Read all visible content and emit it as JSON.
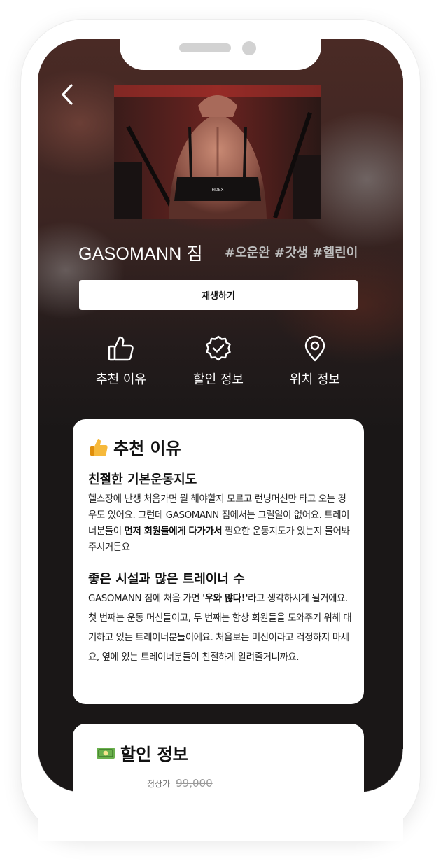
{
  "gym": {
    "name": "GASOMANN 짐",
    "tags": "#오운완 #갓생 #헬린이",
    "play_label": "재생하기",
    "video_brand": "HDEX"
  },
  "nav": [
    {
      "label": "추천 이유",
      "icon": "thumbs-up-icon"
    },
    {
      "label": "할인 정보",
      "icon": "badge-check-icon"
    },
    {
      "label": "위치 정보",
      "icon": "map-pin-icon"
    }
  ],
  "recommend": {
    "heading": "추천 이유",
    "emoji": "thumbs-up-emoji",
    "section1_title": "친절한 기본운동지도",
    "section1_pre": " 헬스장에 난생 처음가면 뭘 해야할지 모르고 런닝머신만 타고 오는 경우도 있어요. 그런데 GASOMANN 짐에서는 그럴일이 없어요. 트레이너분들이 ",
    "section1_bold": "먼저 회원들에게 다가가서",
    "section1_post": " 필요한 운동지도가 있는지 물어봐주시거든요",
    "section2_title": "좋은 시설과 많은 트레이너 수",
    "section2_pre": " GASOMANN 짐에 처음 가면 ",
    "section2_bold": "'우와 많다!'",
    "section2_post": "라고 생각하시게 될거에요. 첫 번째는 운동 머신들이고, 두 번째는 항상 회원들을 도와주기 위해 대기하고 있는 트레이너분들이에요. 처음보는 머신이라고 걱정하지 마세요, 옆에 있는 트레이너분들이 친절하게 알려줄거니까요."
  },
  "discount": {
    "heading": "할인 정보",
    "emoji": "money-emoji",
    "price_label": "정상가",
    "price_value": "99,000"
  },
  "colors": {
    "screen_bg": "#1a1717",
    "card_bg": "#ffffff",
    "tag_text": "#bdbdbd",
    "thumb_emoji": "#f6b93b",
    "money_emoji": "#6ab04c"
  }
}
